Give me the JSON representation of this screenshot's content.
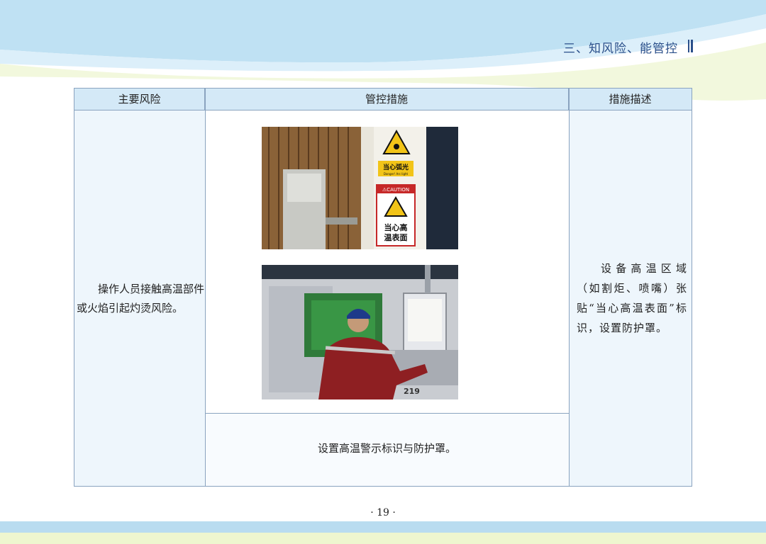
{
  "header": {
    "section_title": "三、知风险、能管控"
  },
  "table": {
    "headers": [
      "主要风险",
      "管控措施",
      "措施描述"
    ],
    "risk": "操作人员接触高温部件或火焰引起灼烫风险。",
    "measure": "设置高温警示标识与防护罩。",
    "description": "设备高温区域（如割炬、喷嘴）张贴“当心高温表面”标识，设置防护罩。"
  },
  "photos": {
    "sign_top_text": "当心弧光",
    "sign_top_sub": "Danger! Arc light",
    "sign_caution": "⚠CAUTION",
    "sign_bottom_line1": "当心高",
    "sign_bottom_line2": "温表面",
    "machine_number": "219"
  },
  "footer": {
    "page_number": "· 19 ·"
  },
  "colors": {
    "accent": "#2a4f8a",
    "header_cell": "#d4e9f7",
    "cell_bg": "#eef6fc"
  }
}
